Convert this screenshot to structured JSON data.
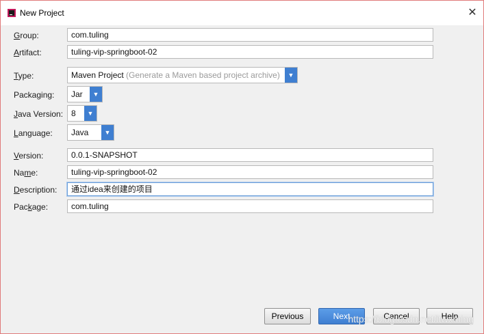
{
  "window": {
    "title": "New Project"
  },
  "form": {
    "group": {
      "label": "Group:",
      "value": "com.tuling"
    },
    "artifact": {
      "label": "Artifact:",
      "value": "tuling-vip-springboot-02"
    },
    "type": {
      "label": "Type:",
      "value": "Maven Project",
      "hint": "(Generate a Maven based project archive)"
    },
    "packaging": {
      "label": "Packaging:",
      "value": "Jar"
    },
    "java_version": {
      "label": "Java Version:",
      "value": "8"
    },
    "language": {
      "label": "Language:",
      "value": "Java"
    },
    "version": {
      "label": "Version:",
      "value": "0.0.1-SNAPSHOT"
    },
    "name": {
      "label": "Name:",
      "value": "tuling-vip-springboot-02"
    },
    "description": {
      "label": "Description:",
      "value": "通过idea来创建的项目"
    },
    "package": {
      "label": "Package:",
      "value": "com.tuling"
    }
  },
  "buttons": {
    "previous": "Previous",
    "next": "Next",
    "cancel": "Cancel",
    "help": "Help"
  },
  "watermark": "https://blog.csdn.net/itwxming",
  "colors": {
    "accent": "#3f7fd1",
    "window_border": "#e07a7a",
    "background": "#f0f0f0"
  },
  "icons": {
    "app": "intellij-idea-icon",
    "close": "close-icon",
    "dropdown": "chevron-down-icon"
  }
}
